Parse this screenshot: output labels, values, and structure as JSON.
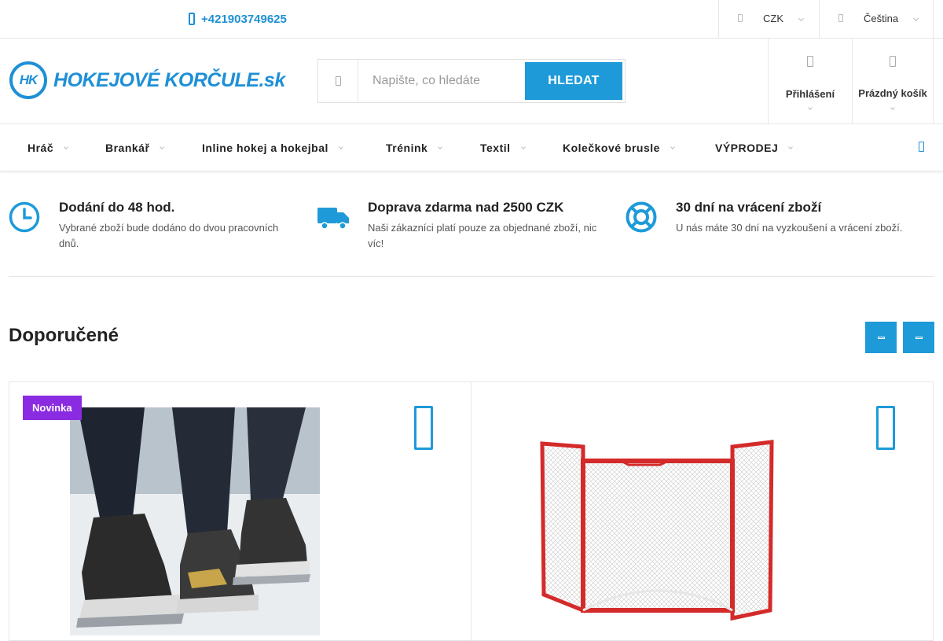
{
  "topbar": {
    "phone": "+421903749625",
    "currency": "CZK",
    "language": "Čeština"
  },
  "header": {
    "logo_text": "HOKEJOVÉ KORČULE.sk",
    "logo_mark": "HK",
    "search_placeholder": "Napište, co hledáte",
    "search_button": "HLEDAT",
    "login_label": "Přihlášení",
    "cart_label": "Prázdný košík"
  },
  "nav": {
    "items": [
      {
        "label": "Hráč"
      },
      {
        "label": "Brankář"
      },
      {
        "label": "Inline hokej a hokejbal"
      },
      {
        "label": "Trénink"
      },
      {
        "label": "Textil"
      },
      {
        "label": "Kolečkové brusle"
      },
      {
        "label": "VÝPRODEJ"
      }
    ]
  },
  "benefits": [
    {
      "icon": "clock-icon",
      "title": "Dodání do 48 hod.",
      "text": "Vybrané zboží bude dodáno do dvou pracovních dnů."
    },
    {
      "icon": "truck-icon",
      "title": "Doprava zdarma nad 2500 CZK",
      "text": "Naši zákazníci platí pouze za objednané zboží, nic víc!"
    },
    {
      "icon": "lifebuoy-icon",
      "title": "30 dní na vrácení zboží",
      "text": "U nás máte 30 dní na vyzkoušení a vrácení zboží."
    }
  ],
  "recommended": {
    "title": "Doporučené",
    "products": [
      {
        "badge": "Novinka",
        "image": "skates-photo"
      },
      {
        "badge": "",
        "image": "hockey-goal-photo"
      }
    ]
  },
  "colors": {
    "accent": "#1e9ad8",
    "badge": "#8a2be2"
  }
}
